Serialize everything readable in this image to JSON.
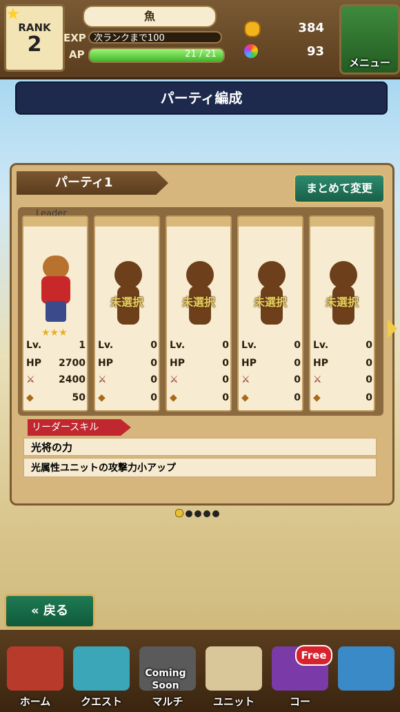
{
  "header": {
    "rank_label": "RANK",
    "rank_value": "2",
    "player_name": "魚",
    "exp_label": "EXP",
    "exp_text": "次ランクまで100",
    "ap_label": "AP",
    "ap_text": "21 / 21",
    "ap_fraction": 1.0,
    "currency1": "384",
    "currency2": "93",
    "menu_label": "メニュー"
  },
  "page_title": "パーティ編成",
  "party": {
    "tab_label": "パーティ1",
    "bulk_change_label": "まとめて変更",
    "leader_label": "Leader",
    "unselected_label": "未選択",
    "stat_labels": {
      "lv": "Lv.",
      "hp": "HP"
    },
    "slots": [
      {
        "lv": "1",
        "hp": "2700",
        "atk": "2400",
        "cost": "50",
        "filled": true
      },
      {
        "lv": "0",
        "hp": "0",
        "atk": "0",
        "cost": "0",
        "filled": false
      },
      {
        "lv": "0",
        "hp": "0",
        "atk": "0",
        "cost": "0",
        "filled": false
      },
      {
        "lv": "0",
        "hp": "0",
        "atk": "0",
        "cost": "0",
        "filled": false
      },
      {
        "lv": "0",
        "hp": "0",
        "atk": "0",
        "cost": "0",
        "filled": false
      }
    ],
    "leader_skill_header": "リーダースキル",
    "leader_skill_name": "光将の力",
    "leader_skill_desc": "光属性ユニットの攻撃力小アップ"
  },
  "pager": {
    "total": 5,
    "current": 1
  },
  "back_label": "戻る",
  "nav": {
    "items": [
      {
        "label": "ホーム"
      },
      {
        "label": "クエスト"
      },
      {
        "label": "マルチ"
      },
      {
        "label": "ユニット"
      },
      {
        "label": "コー"
      },
      {
        "label": ""
      }
    ],
    "coming_soon": "Coming Soon",
    "free_badge": "Free"
  },
  "colors": {
    "accent_green": "#176048",
    "panel": "#d6b67c",
    "title_bar": "#1d2a4d",
    "skill_red": "#c1272f"
  }
}
